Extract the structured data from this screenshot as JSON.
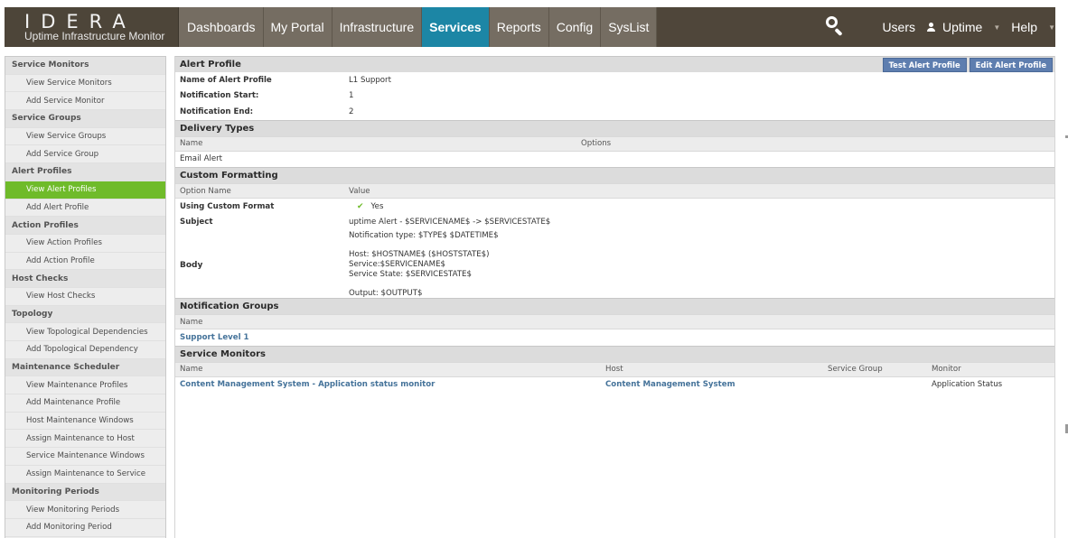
{
  "app": {
    "logo_word": "IDERA",
    "logo_subtitle": "Uptime Infrastructure Monitor"
  },
  "nav": {
    "items": [
      {
        "label": "Dashboards",
        "active": false
      },
      {
        "label": "My Portal",
        "active": false
      },
      {
        "label": "Infrastructure",
        "active": false
      },
      {
        "label": "Services",
        "active": true
      },
      {
        "label": "Reports",
        "active": false
      },
      {
        "label": "Config",
        "active": false
      },
      {
        "label": "SysList",
        "active": false
      }
    ],
    "right": {
      "users": "Users",
      "uptime": "Uptime",
      "help": "Help"
    }
  },
  "sidebar": {
    "groups": [
      {
        "header": "Service Monitors",
        "links": [
          "View Service Monitors",
          "Add Service Monitor"
        ]
      },
      {
        "header": "Service Groups",
        "links": [
          "View Service Groups",
          "Add Service Group"
        ]
      },
      {
        "header": "Alert Profiles",
        "links": [
          "View Alert Profiles",
          "Add Alert Profile"
        ]
      },
      {
        "header": "Action Profiles",
        "links": [
          "View Action Profiles",
          "Add Action Profile"
        ]
      },
      {
        "header": "Host Checks",
        "links": [
          "View Host Checks"
        ]
      },
      {
        "header": "Topology",
        "links": [
          "View Topological Dependencies",
          "Add Topological Dependency"
        ]
      },
      {
        "header": "Maintenance Scheduler",
        "links": [
          "View Maintenance Profiles",
          "Add Maintenance Profile",
          "Host Maintenance Windows",
          "Assign Maintenance to Host",
          "Service Maintenance Windows",
          "Assign Maintenance to Service"
        ]
      },
      {
        "header": "Monitoring Periods",
        "links": [
          "View Monitoring Periods",
          "Add Monitoring Period"
        ]
      }
    ],
    "active_link": "View Alert Profiles"
  },
  "alert_profile": {
    "section_title": "Alert Profile",
    "test_button": "Test Alert Profile",
    "edit_button": "Edit Alert Profile",
    "fields": [
      {
        "label": "Name of Alert Profile",
        "value": "L1 Support"
      },
      {
        "label": "Notification Start:",
        "value": "1"
      },
      {
        "label": "Notification End:",
        "value": "2"
      }
    ]
  },
  "delivery_types": {
    "section_title": "Delivery Types",
    "col_name": "Name",
    "col_options": "Options",
    "rows": [
      {
        "name": "Email Alert",
        "options": ""
      }
    ]
  },
  "custom_formatting": {
    "section_title": "Custom Formatting",
    "col_option": "Option Name",
    "col_value": "Value",
    "using_label": "Using Custom Format",
    "using_value": "Yes",
    "subject_label": "Subject",
    "subject_value": "uptime Alert - $SERVICENAME$ -> $SERVICESTATE$",
    "body_label": "Body",
    "body_lines": [
      "Notification type: $TYPE$ $DATETIME$",
      "Host: $HOSTNAME$ ($HOSTSTATE$)",
      "Service:$SERVICENAME$",
      "Service State: $SERVICESTATE$",
      "Output: $OUTPUT$"
    ]
  },
  "notification_groups": {
    "section_title": "Notification Groups",
    "col_name": "Name",
    "rows": [
      "Support Level 1"
    ]
  },
  "service_monitors": {
    "section_title": "Service Monitors",
    "cols": {
      "name": "Name",
      "host": "Host",
      "group": "Service Group",
      "monitor": "Monitor"
    },
    "rows": [
      {
        "name": "Content Management System - Application status monitor",
        "host": "Content Management System",
        "group": "",
        "monitor": "Application Status"
      }
    ]
  },
  "colors": {
    "nav_bg": "#756d62",
    "nav_active": "#1c86a5",
    "sidebar_active": "#6fbb2a",
    "button_bg": "#5e7eaf",
    "link": "#45739a"
  }
}
